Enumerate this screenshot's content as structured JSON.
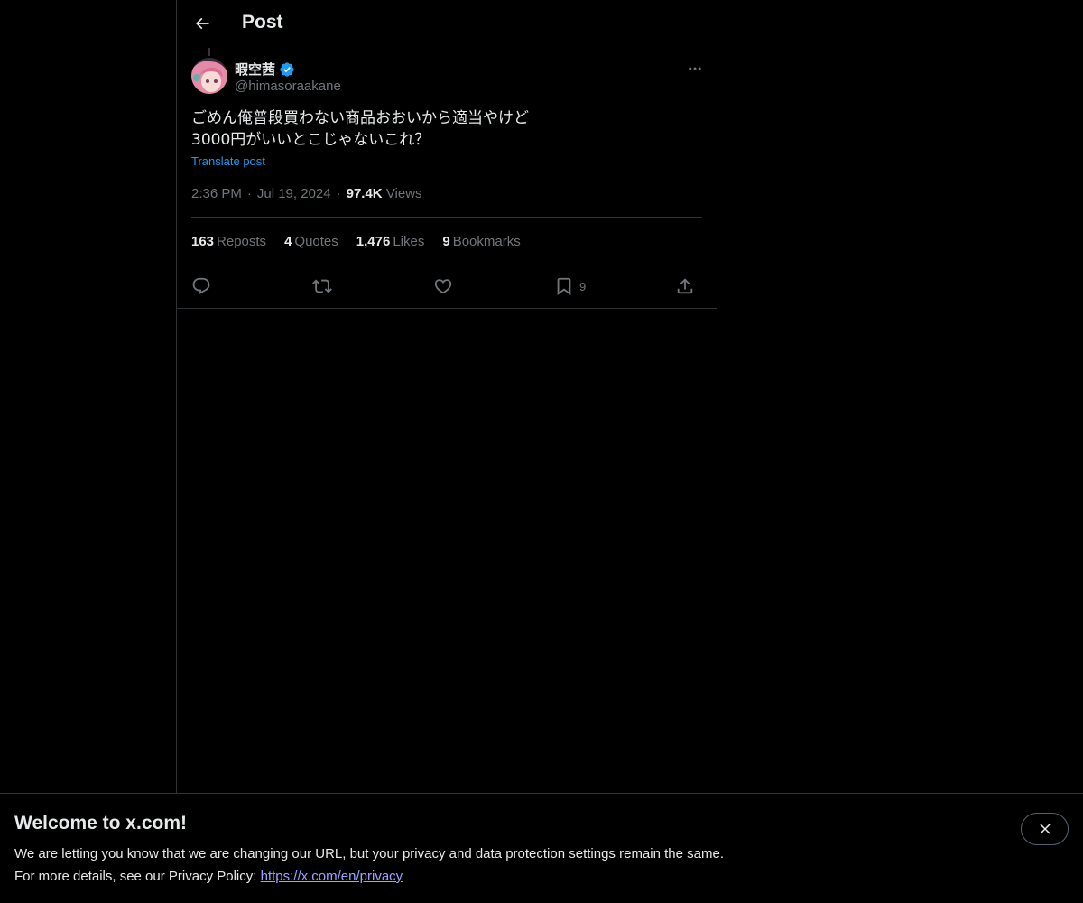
{
  "header": {
    "title": "Post"
  },
  "post": {
    "author": {
      "display_name": "暇空茜",
      "handle": "@himasoraakane",
      "verified": true
    },
    "text_lines": [
      "ごめん俺普段買わない商品おおいから適当やけど",
      "3000円がいいとこじゃないこれ？"
    ],
    "translate_label": "Translate post",
    "time": "2:36 PM",
    "date": "Jul 19, 2024",
    "views_count": "97.4K",
    "views_label": "Views",
    "stats": {
      "reposts": {
        "count": "163",
        "label": "Reposts"
      },
      "quotes": {
        "count": "4",
        "label": "Quotes"
      },
      "likes": {
        "count": "1,476",
        "label": "Likes"
      },
      "bookmarks": {
        "count": "9",
        "label": "Bookmarks"
      }
    },
    "actions": {
      "reply_icon": "reply-icon",
      "repost_icon": "repost-icon",
      "like_icon": "heart-icon",
      "bookmark_icon": "bookmark-icon",
      "bookmark_count": "9",
      "share_icon": "share-icon"
    }
  },
  "banner": {
    "title": "Welcome to x.com!",
    "line1": "We are letting you know that we are changing our URL, but your privacy and data protection settings remain the same.",
    "line2_prefix": "For more details, see our Privacy Policy:",
    "link": "https://x.com/en/privacy"
  },
  "colors": {
    "background": "#000000",
    "text_primary": "#e7e9ea",
    "text_secondary": "#71767b",
    "link": "#1d9bf0",
    "verified": "#1d9bf0",
    "border": "#2f3336"
  }
}
